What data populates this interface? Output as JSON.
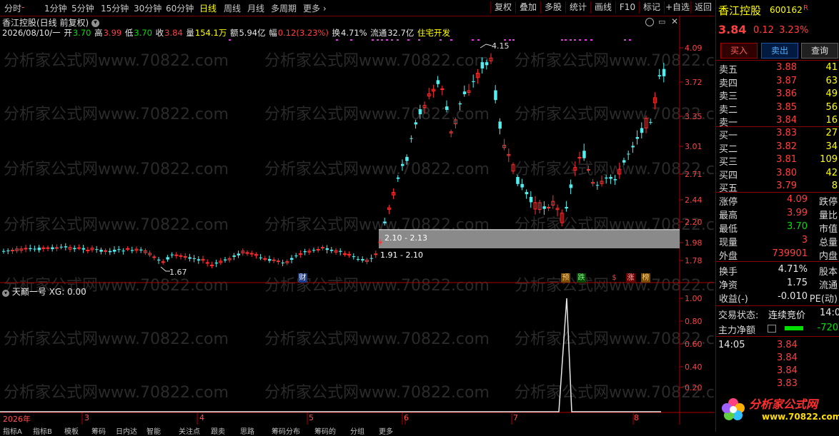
{
  "toolbar": {
    "periods": [
      "分时",
      "1分钟",
      "5分钟",
      "15分钟",
      "30分钟",
      "60分钟",
      "日线",
      "周线",
      "月线",
      "多周期",
      "更多"
    ],
    "active_period": "日线",
    "buttons": [
      "复权",
      "叠加",
      "多股",
      "统计",
      "画线",
      "F10",
      "标记",
      "+自选",
      "返回"
    ]
  },
  "chart_header": {
    "title": "香江控股(日线 前复权)",
    "date": "2026/08/10/一",
    "open_label": "开",
    "open": "3.70",
    "high_label": "高",
    "high": "3.99",
    "low_label": "低",
    "low": "3.70",
    "close_label": "收",
    "close": "3.84",
    "volume_label": "量",
    "volume": "154.1万",
    "amount_label": "额",
    "amount": "5.94亿",
    "change_label": "幅",
    "change": "0.12(3.23%)",
    "turnover_label": "换",
    "turnover": "4.71%",
    "float_label": "流通",
    "float_cap": "32.7亿",
    "concept": "住宅开发"
  },
  "price_axis": [
    "4.09",
    "3.72",
    "3.35",
    "3.01",
    "2.71",
    "2.44",
    "2.20",
    "1.98",
    "1.78"
  ],
  "annotations": {
    "peak": "4.15",
    "low": "1.67",
    "zone_upper": "2.10 - 2.13",
    "zone_lower": "1.91 - 2.10"
  },
  "event_tags": [
    "财",
    "预",
    "跌",
    "$",
    "涨",
    "榜"
  ],
  "indicator": {
    "name": "天巅一号",
    "value_text": "XG: 0.00",
    "axis": [
      "1.00",
      "0.80",
      "0.60",
      "0.40",
      "0.20"
    ]
  },
  "time_axis": [
    "2026年",
    "3",
    "4",
    "5",
    "6",
    "7",
    "8"
  ],
  "bottom_tabs": [
    "指标A",
    "指标B",
    "模板",
    "筹码",
    "日内达",
    "智能",
    "关注点",
    "跟卖",
    "思路",
    "筹码分布",
    "筹码的",
    "分组",
    "更多"
  ],
  "watermark": "分析家公式网www.70822.com",
  "quote_panel": {
    "name": "香江控股",
    "code": "600162",
    "badge": "R",
    "price": "3.84",
    "change": "0.12",
    "change_pct": "3.23%",
    "buy_btn": "买入",
    "sell_btn": "卖出",
    "query_btn": "查询",
    "asks": [
      {
        "label": "卖五",
        "price": "3.88",
        "vol": "41"
      },
      {
        "label": "卖四",
        "price": "3.87",
        "vol": "63"
      },
      {
        "label": "卖三",
        "price": "3.86",
        "vol": "49"
      },
      {
        "label": "卖二",
        "price": "3.85",
        "vol": "56"
      },
      {
        "label": "卖一",
        "price": "3.84",
        "vol": "16"
      }
    ],
    "bids": [
      {
        "label": "买一",
        "price": "3.83",
        "vol": "27"
      },
      {
        "label": "买二",
        "price": "3.82",
        "vol": "34"
      },
      {
        "label": "买三",
        "price": "3.81",
        "vol": "109"
      },
      {
        "label": "买四",
        "price": "3.80",
        "vol": "42"
      },
      {
        "label": "买五",
        "price": "3.79",
        "vol": "8"
      }
    ],
    "stats": [
      {
        "l1": "涨停",
        "v1": "4.09",
        "l2": "跌停"
      },
      {
        "l1": "最高",
        "v1": "3.99",
        "l2": "量比"
      },
      {
        "l1": "最低",
        "v1": "3.70",
        "l2": "市值"
      },
      {
        "l1": "现量",
        "v1": "3",
        "l2": "总量"
      },
      {
        "l1": "外盘",
        "v1": "739901",
        "l2": "内盘"
      }
    ],
    "stats2": [
      {
        "l1": "换手",
        "v1": "4.71%",
        "l2": "股本"
      },
      {
        "l1": "净资",
        "v1": "1.75",
        "l2": "流通"
      },
      {
        "l1": "收益(-)",
        "v1": "-0.010",
        "l2": "PE(动)"
      }
    ],
    "trade_state_label": "交易状态:",
    "trade_state": "连续竞价",
    "trade_time_short": "14:0",
    "mainforce_label": "主力净额",
    "mainforce_value": "-720",
    "ticks_time": "14:05",
    "ticks": [
      "3.84",
      "3.84",
      "3.84",
      "3.83"
    ],
    "logo_text": "分析家公式网",
    "logo_url": "www.70822.com"
  },
  "colors": {
    "up": "#ff3030",
    "down": "#50f0f0",
    "axis": "#c00000",
    "bg": "#000000"
  }
}
